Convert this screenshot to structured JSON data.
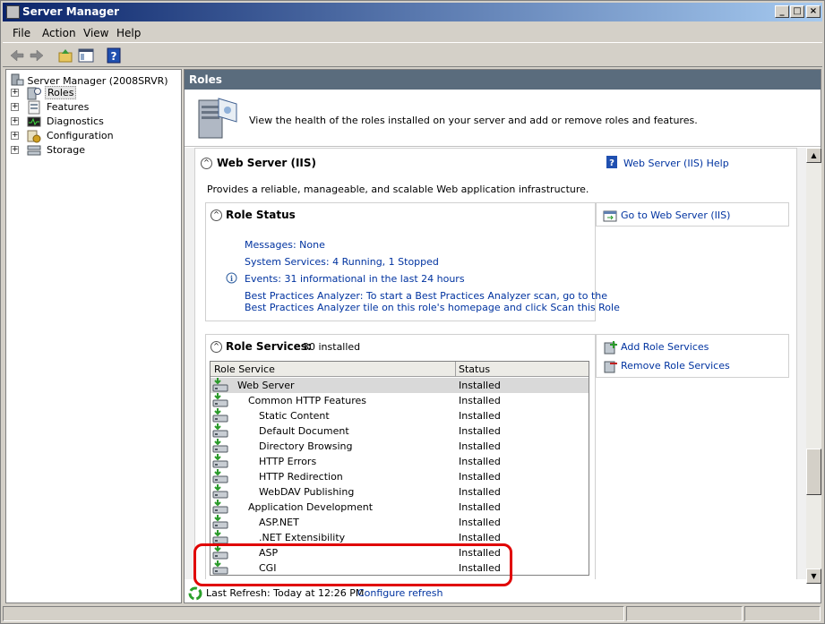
{
  "window": {
    "title": "Server Manager"
  },
  "menu": [
    "File",
    "Action",
    "View",
    "Help"
  ],
  "tree": {
    "root": "Server Manager (2008SRVR)",
    "items": [
      {
        "label": "Roles",
        "icon": "roles-icon",
        "selected": true
      },
      {
        "label": "Features",
        "icon": "features-icon"
      },
      {
        "label": "Diagnostics",
        "icon": "diagnostics-icon"
      },
      {
        "label": "Configuration",
        "icon": "configuration-icon"
      },
      {
        "label": "Storage",
        "icon": "storage-icon"
      }
    ]
  },
  "roles": {
    "header": "Roles",
    "description": "View the health of the roles installed on your server and add or remove roles and features."
  },
  "web_server": {
    "title": "Web Server (IIS)",
    "help_link": "Web Server (IIS) Help",
    "description": "Provides a reliable, manageable, and scalable Web application infrastructure.",
    "role_status": {
      "title": "Role Status",
      "goto_link": "Go to Web Server (IIS)",
      "messages": "Messages: None",
      "services": "System Services: 4 Running, 1 Stopped",
      "events": "Events: 31 informational in the last 24 hours",
      "bpa_line1": "Best Practices Analyzer: To start a Best Practices Analyzer scan, go to the",
      "bpa_line2": "Best Practices Analyzer tile on this role's homepage and click Scan this Role"
    },
    "role_services": {
      "title": "Role Services:",
      "count": "30 installed",
      "add_link": "Add Role Services",
      "remove_link": "Remove Role Services",
      "columns": [
        "Role Service",
        "Status"
      ],
      "rows": [
        {
          "name": "Web Server",
          "status": "Installed"
        },
        {
          "name": "Common HTTP Features",
          "status": "Installed"
        },
        {
          "name": "Static Content",
          "status": "Installed"
        },
        {
          "name": "Default Document",
          "status": "Installed"
        },
        {
          "name": "Directory Browsing",
          "status": "Installed"
        },
        {
          "name": "HTTP Errors",
          "status": "Installed"
        },
        {
          "name": "HTTP Redirection",
          "status": "Installed"
        },
        {
          "name": "WebDAV Publishing",
          "status": "Installed"
        },
        {
          "name": "Application Development",
          "status": "Installed"
        },
        {
          "name": "ASP.NET",
          "status": "Installed"
        },
        {
          "name": ".NET Extensibility",
          "status": "Installed"
        },
        {
          "name": "ASP",
          "status": "Installed"
        },
        {
          "name": "CGI",
          "status": "Installed"
        }
      ]
    }
  },
  "refresh": {
    "text": "Last Refresh: Today at 12:26 PM",
    "link": "Configure refresh"
  },
  "colors": {
    "header_bar": "#5a6c7d",
    "link": "#0033a0",
    "annotation": "#e00000"
  }
}
